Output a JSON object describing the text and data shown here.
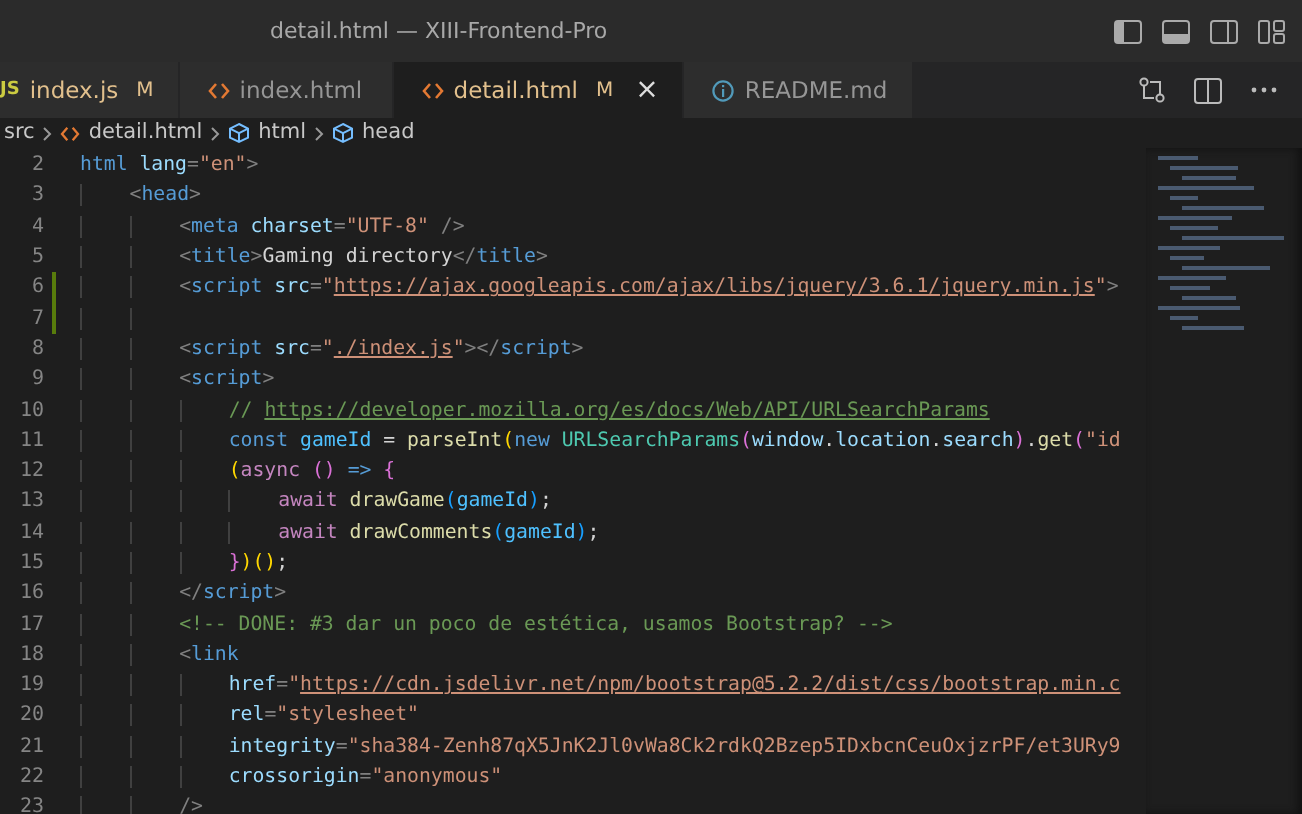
{
  "window": {
    "title": "detail.html — XIII-Frontend-Pro"
  },
  "tabs": [
    {
      "label": "index.js",
      "kind": "js",
      "badge": "JS",
      "modified": true,
      "selected": false,
      "status": "M"
    },
    {
      "label": "index.html",
      "kind": "html",
      "modified": false,
      "selected": false
    },
    {
      "label": "detail.html",
      "kind": "html",
      "modified": true,
      "selected": true,
      "status": "M",
      "close": "×"
    },
    {
      "label": "README.md",
      "kind": "info",
      "modified": false,
      "selected": false
    }
  ],
  "breadcrumbs": [
    {
      "label": "src",
      "kind": "folder"
    },
    {
      "label": "detail.html",
      "kind": "html"
    },
    {
      "label": "html",
      "kind": "element"
    },
    {
      "label": "head",
      "kind": "element"
    }
  ],
  "editor": {
    "lines": [
      {
        "number": "2",
        "changed": false,
        "tokens": [
          {
            "kind": "tag",
            "text": "html"
          },
          {
            "kind": "attr",
            "text": " lang"
          },
          {
            "kind": "p",
            "text": "="
          },
          {
            "kind": "str",
            "text": "\"en\""
          },
          {
            "kind": "p",
            "text": ">"
          }
        ]
      },
      {
        "number": "3",
        "changed": false,
        "tokens": [
          {
            "kind": "p",
            "text": "    <"
          },
          {
            "kind": "tag",
            "text": "head"
          },
          {
            "kind": "p",
            "text": ">"
          }
        ]
      },
      {
        "number": "4",
        "changed": false,
        "tokens": [
          {
            "kind": "p",
            "text": "        <"
          },
          {
            "kind": "tag",
            "text": "meta"
          },
          {
            "kind": "attr",
            "text": " charset"
          },
          {
            "kind": "p",
            "text": "="
          },
          {
            "kind": "str",
            "text": "\"UTF-8\""
          },
          {
            "kind": "p",
            "text": " />"
          }
        ]
      },
      {
        "number": "5",
        "changed": false,
        "tokens": [
          {
            "kind": "p",
            "text": "        <"
          },
          {
            "kind": "tag",
            "text": "title"
          },
          {
            "kind": "p",
            "text": ">"
          },
          {
            "kind": "txt",
            "text": "Gaming directory"
          },
          {
            "kind": "p",
            "text": "</"
          },
          {
            "kind": "tag",
            "text": "title"
          },
          {
            "kind": "p",
            "text": ">"
          }
        ]
      },
      {
        "number": "6",
        "changed": true,
        "tokens": [
          {
            "kind": "p",
            "text": "        <"
          },
          {
            "kind": "tag",
            "text": "script"
          },
          {
            "kind": "attr",
            "text": " src"
          },
          {
            "kind": "p",
            "text": "="
          },
          {
            "kind": "str",
            "text": "\""
          },
          {
            "kind": "url",
            "text": "https://ajax.googleapis.com/ajax/libs/jquery/3.6.1/jquery.min.js"
          },
          {
            "kind": "str",
            "text": "\""
          },
          {
            "kind": "p",
            "text": ">"
          }
        ]
      },
      {
        "number": "7",
        "changed": true
      },
      {
        "number": "8",
        "changed": false,
        "tokens": [
          {
            "kind": "p",
            "text": "        <"
          },
          {
            "kind": "tag",
            "text": "script"
          },
          {
            "kind": "attr",
            "text": " src"
          },
          {
            "kind": "p",
            "text": "="
          },
          {
            "kind": "str",
            "text": "\""
          },
          {
            "kind": "url",
            "text": "./index.js"
          },
          {
            "kind": "str",
            "text": "\""
          },
          {
            "kind": "p",
            "text": "></"
          },
          {
            "kind": "tag",
            "text": "script"
          },
          {
            "kind": "p",
            "text": ">"
          }
        ]
      },
      {
        "number": "9",
        "changed": false,
        "tokens": [
          {
            "kind": "p",
            "text": "        <"
          },
          {
            "kind": "tag",
            "text": "script"
          },
          {
            "kind": "p",
            "text": ">"
          }
        ]
      },
      {
        "number": "10",
        "changed": false,
        "tokens": [
          {
            "kind": "cm",
            "text": "            // "
          },
          {
            "kind": "cmurl",
            "text": "https://developer.mozilla.org/es/docs/Web/API/URLSearchParams"
          }
        ]
      },
      {
        "number": "11",
        "changed": false,
        "tokens": [
          {
            "kind": "kw",
            "text": "            const"
          },
          {
            "kind": "cvar",
            "text": " gameId"
          },
          {
            "kind": "txt",
            "text": " = "
          },
          {
            "kind": "fn",
            "text": "parseInt"
          },
          {
            "kind": "b1",
            "text": "("
          },
          {
            "kind": "kw",
            "text": "new"
          },
          {
            "kind": "cls",
            "text": " URLSearchParams"
          },
          {
            "kind": "b2",
            "text": "("
          },
          {
            "kind": "var",
            "text": "window"
          },
          {
            "kind": "txt",
            "text": "."
          },
          {
            "kind": "var",
            "text": "location"
          },
          {
            "kind": "txt",
            "text": "."
          },
          {
            "kind": "var",
            "text": "search"
          },
          {
            "kind": "b2",
            "text": ")"
          },
          {
            "kind": "txt",
            "text": "."
          },
          {
            "kind": "fn",
            "text": "get"
          },
          {
            "kind": "b2",
            "text": "("
          },
          {
            "kind": "str",
            "text": "\"id"
          }
        ]
      },
      {
        "number": "12",
        "changed": false,
        "tokens": [
          {
            "kind": "b1",
            "text": "            ("
          },
          {
            "kind": "ctl",
            "text": "async"
          },
          {
            "kind": "b2",
            "text": " ()"
          },
          {
            "kind": "kw",
            "text": " =>"
          },
          {
            "kind": "b2",
            "text": " {"
          }
        ]
      },
      {
        "number": "13",
        "changed": false,
        "tokens": [
          {
            "kind": "ctl",
            "text": "                await"
          },
          {
            "kind": "fn",
            "text": " drawGame"
          },
          {
            "kind": "b3",
            "text": "("
          },
          {
            "kind": "cvar",
            "text": "gameId"
          },
          {
            "kind": "b3",
            "text": ")"
          },
          {
            "kind": "txt",
            "text": ";"
          }
        ]
      },
      {
        "number": "14",
        "changed": false,
        "tokens": [
          {
            "kind": "ctl",
            "text": "                await"
          },
          {
            "kind": "fn",
            "text": " drawComments"
          },
          {
            "kind": "b3",
            "text": "("
          },
          {
            "kind": "cvar",
            "text": "gameId"
          },
          {
            "kind": "b3",
            "text": ")"
          },
          {
            "kind": "txt",
            "text": ";"
          }
        ]
      },
      {
        "number": "15",
        "changed": false,
        "tokens": [
          {
            "kind": "b2",
            "text": "            }"
          },
          {
            "kind": "b1",
            "text": ")()"
          },
          {
            "kind": "txt",
            "text": ";"
          }
        ]
      },
      {
        "number": "16",
        "changed": false,
        "tokens": [
          {
            "kind": "p",
            "text": "        </"
          },
          {
            "kind": "tag",
            "text": "script"
          },
          {
            "kind": "p",
            "text": ">"
          }
        ]
      },
      {
        "number": "17",
        "changed": false,
        "tokens": [
          {
            "kind": "cm",
            "text": "        <!-- DONE: #3 dar un poco de estética, usamos Bootstrap? -->"
          }
        ]
      },
      {
        "number": "18",
        "changed": false,
        "tokens": [
          {
            "kind": "p",
            "text": "        <"
          },
          {
            "kind": "tag",
            "text": "link"
          }
        ]
      },
      {
        "number": "19",
        "changed": false,
        "tokens": [
          {
            "kind": "attr",
            "text": "            href"
          },
          {
            "kind": "p",
            "text": "="
          },
          {
            "kind": "str",
            "text": "\""
          },
          {
            "kind": "url",
            "text": "https://cdn.jsdelivr.net/npm/bootstrap@5.2.2/dist/css/bootstrap.min.c"
          }
        ]
      },
      {
        "number": "20",
        "changed": false,
        "tokens": [
          {
            "kind": "attr",
            "text": "            rel"
          },
          {
            "kind": "p",
            "text": "="
          },
          {
            "kind": "str",
            "text": "\"stylesheet\""
          }
        ]
      },
      {
        "number": "21",
        "changed": false,
        "tokens": [
          {
            "kind": "attr",
            "text": "            integrity"
          },
          {
            "kind": "p",
            "text": "="
          },
          {
            "kind": "str",
            "text": "\"sha384-Zenh87qX5JnK2Jl0vWa8Ck2rdkQ2Bzep5IDxbcnCeuOxjzrPF/et3URy9"
          }
        ]
      },
      {
        "number": "22",
        "changed": false,
        "tokens": [
          {
            "kind": "attr",
            "text": "            crossorigin"
          },
          {
            "kind": "p",
            "text": "="
          },
          {
            "kind": "str",
            "text": "\"anonymous\""
          }
        ]
      },
      {
        "number": "23",
        "changed": false,
        "tokens": [
          {
            "kind": "p",
            "text": "        />"
          }
        ]
      }
    ]
  }
}
